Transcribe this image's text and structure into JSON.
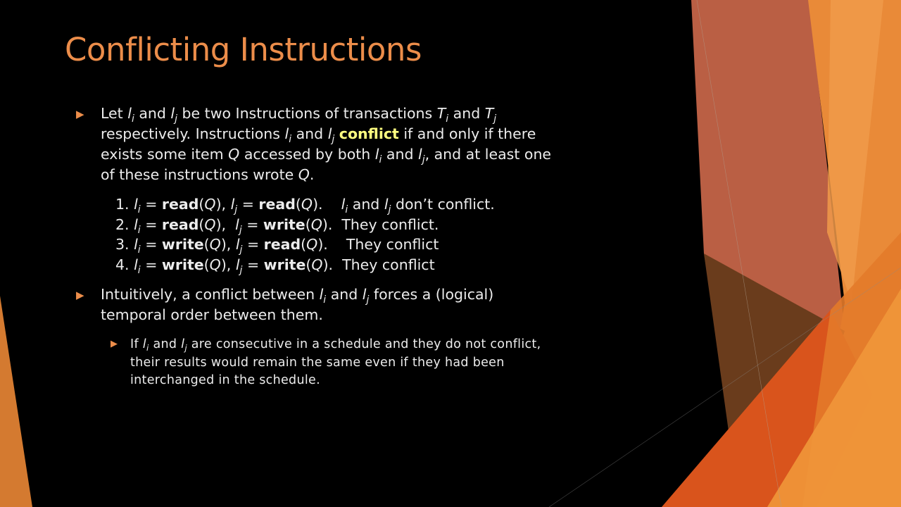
{
  "slide": {
    "title": "Conflicting Instructions",
    "colors": {
      "title": "#ec8d4a",
      "highlight": "#ffff80",
      "bullet": "#ec8d4a",
      "text": "#ececec"
    }
  },
  "bullet1": {
    "l1_a": "Let ",
    "l1_b": " and ",
    "l1_c": "  be two Instructions of transactions ",
    "l1_d": " and ",
    "l2_a": "respectively.  Instructions ",
    "l2_b": " and ",
    "l2_highlight": "conflict",
    "l2_c": " if and only if there",
    "l3_a": "exists some item ",
    "l3_b": " accessed by both ",
    "l3_c": " and ",
    "l3_d": ", and at least one",
    "l4_a": "of these instructions wrote ",
    "l4_b": "."
  },
  "cases": [
    {
      "num": "1.",
      "op1": "read",
      "op2": "read",
      "note": "don’t conflict."
    },
    {
      "num": "2.",
      "op1": "read",
      "op2": "write",
      "note": "They conflict."
    },
    {
      "num": "3.",
      "op1": "write",
      "op2": "read",
      "note": "They conflict"
    },
    {
      "num": "4.",
      "op1": "write",
      "op2": "write",
      "note": "They conflict"
    }
  ],
  "bullet2": {
    "l1_a": "Intuitively, a conflict between ",
    "l1_b": " and ",
    "l1_c": " forces a (logical)",
    "l2": "temporal order between them."
  },
  "subbullet": {
    "l1_a": "If ",
    "l1_b": " and ",
    "l1_c": " are consecutive  in a schedule and they do not conflict,",
    "l2": "their results would remain the same even if they had been",
    "l3": "interchanged in the schedule."
  },
  "symbols": {
    "l": "l",
    "T": "T",
    "i": "i",
    "j": "j",
    "Q": "Q",
    "arrow": "▶"
  }
}
